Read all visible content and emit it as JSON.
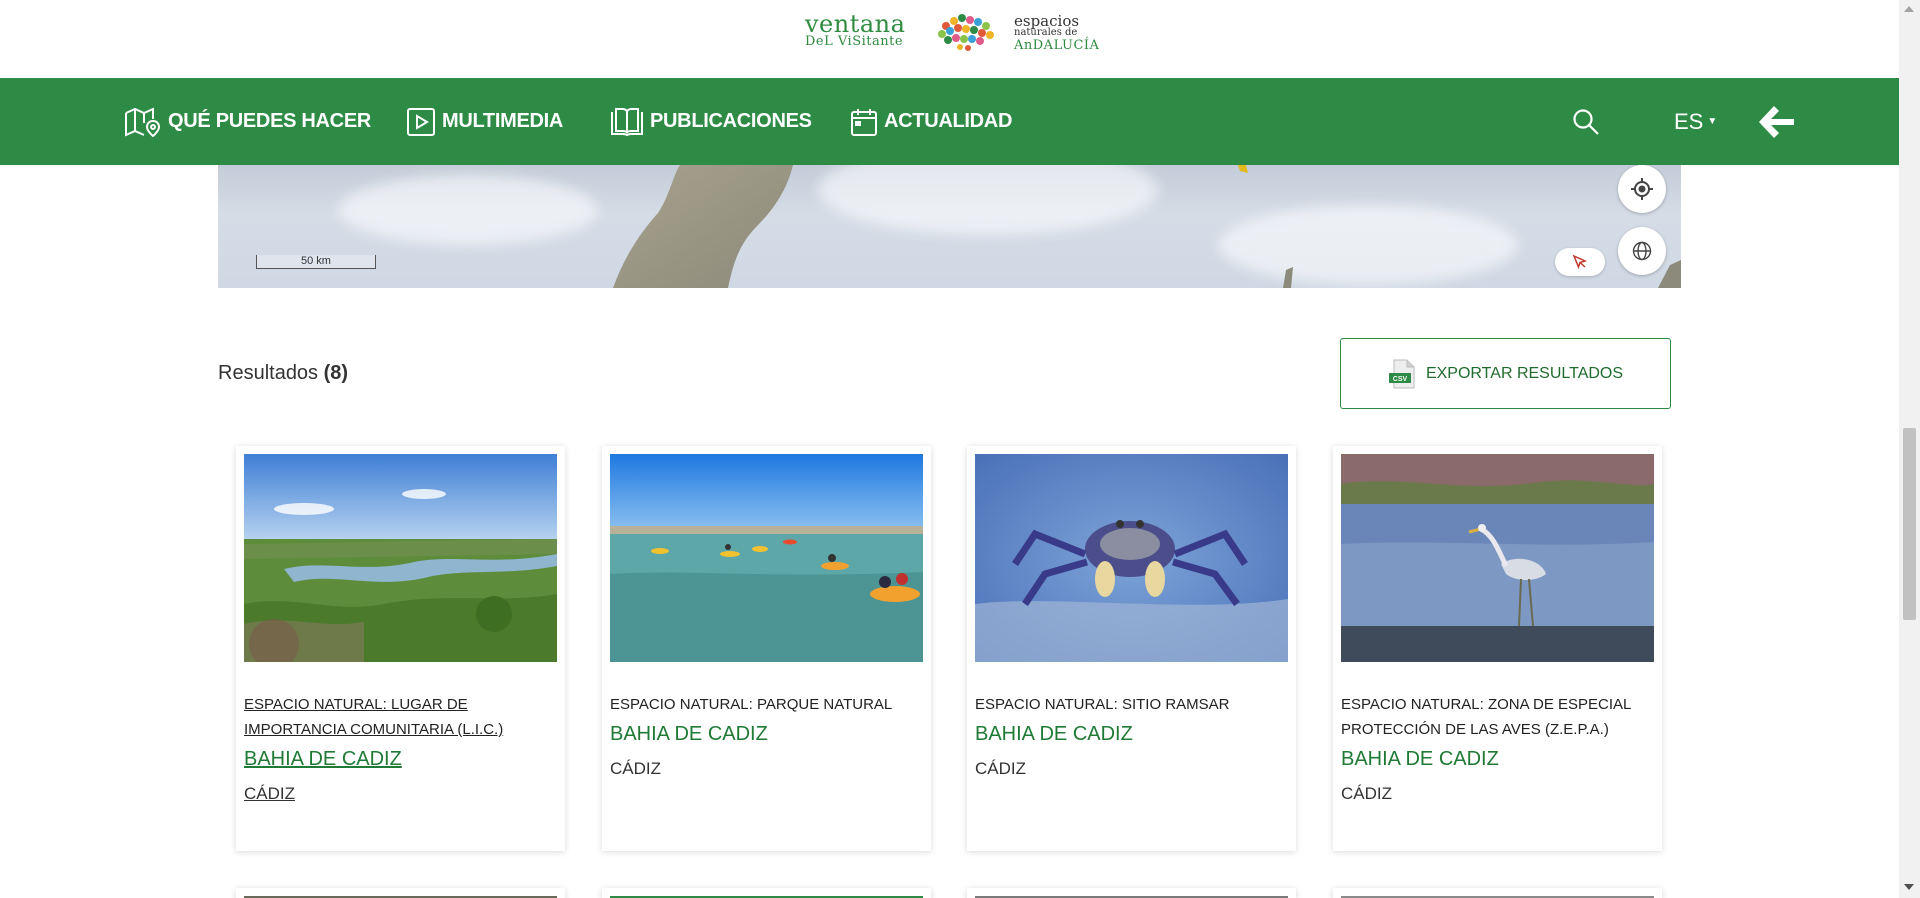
{
  "logo": {
    "line1": "ventana",
    "line2": "DeL ViSitante",
    "right1": "espacios",
    "right2": "naturales de",
    "right3": "AnDALUCÍA"
  },
  "nav": {
    "items": [
      {
        "label": "QUÉ PUEDES HACER",
        "icon": "map-pin-icon"
      },
      {
        "label": "MULTIMEDIA",
        "icon": "play-icon"
      },
      {
        "label": "PUBLICACIONES",
        "icon": "book-icon"
      },
      {
        "label": "ACTUALIDAD",
        "icon": "calendar-icon"
      }
    ],
    "search_icon": "search-icon",
    "language": "ES",
    "back_icon": "arrow-left-icon"
  },
  "map": {
    "scale_label": "50 km",
    "locate_icon": "crosshair-icon",
    "layers_icon": "globe-icon",
    "select_icon": "cursor-icon"
  },
  "results": {
    "label": "Resultados",
    "count": "(8)",
    "export_label": "EXPORTAR RESULTADOS",
    "export_icon": "csv-file-icon"
  },
  "cards": [
    {
      "type": "ESPACIO NATURAL: LUGAR DE IMPORTANCIA COMUNITARIA (L.I.C.)",
      "title": "BAHIA DE CADIZ",
      "place": "CÁDIZ",
      "image": "marsh-landscape"
    },
    {
      "type": "ESPACIO NATURAL: PARQUE NATURAL",
      "title": "BAHIA DE CADIZ",
      "place": "CÁDIZ",
      "image": "kayaks-on-water"
    },
    {
      "type": "ESPACIO NATURAL: SITIO RAMSAR",
      "title": "BAHIA DE CADIZ",
      "place": "CÁDIZ",
      "image": "fiddler-crab"
    },
    {
      "type": "ESPACIO NATURAL: ZONA DE ESPECIAL PROTECCIÓN DE LAS AVES (Z.E.P.A.)",
      "title": "BAHIA DE CADIZ",
      "place": "CÁDIZ",
      "image": "grey-heron"
    }
  ],
  "colors": {
    "brand_green": "#2e8b45",
    "title_green": "#1f7a35"
  }
}
